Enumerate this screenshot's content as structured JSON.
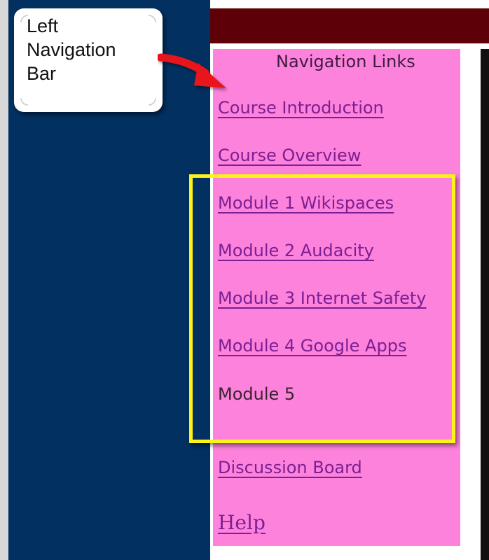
{
  "callout": {
    "line1": "Left",
    "line2": "Navigation",
    "line3": "Bar"
  },
  "nav": {
    "title": "Navigation Links",
    "links": [
      {
        "label": "Course Introduction"
      },
      {
        "label": "Course Overview"
      },
      {
        "label": "Module 1 Wikispaces"
      },
      {
        "label": "Module 2 Audacity"
      },
      {
        "label": "Module 3 Internet Safety"
      },
      {
        "label": "Module 4 Google Apps"
      },
      {
        "label": "Module 5"
      },
      {
        "label": "Discussion Board"
      },
      {
        "label": "Help"
      }
    ]
  },
  "colors": {
    "left_panel": "#023060",
    "top_bar": "#5e0007",
    "nav_panel": "#fd82dc",
    "link": "#7c1f92",
    "highlight": "#fdf21a",
    "arrow": "#e8141c"
  }
}
